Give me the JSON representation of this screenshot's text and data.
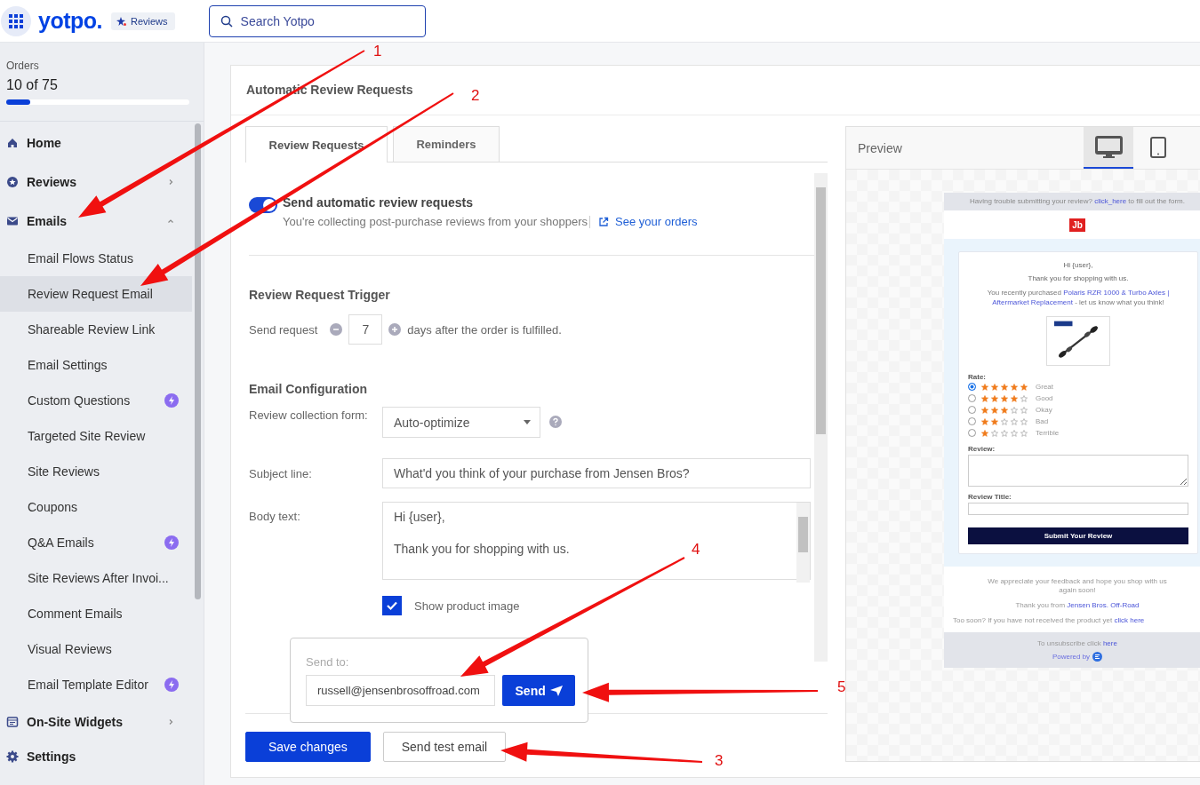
{
  "topbar": {
    "logo": "yotpo.",
    "product_badge": "Reviews",
    "search": {
      "placeholder": "Search Yotpo"
    }
  },
  "sidebar": {
    "orders": {
      "label": "Orders",
      "count": "10 of 75",
      "level": 0.13
    },
    "items": [
      {
        "label": "Home",
        "kind": "link"
      },
      {
        "label": "Reviews",
        "kind": "group",
        "expanded": false
      },
      {
        "label": "Emails",
        "kind": "group",
        "expanded": true,
        "children": [
          {
            "label": "Email Flows Status",
            "selected": false,
            "premium": false
          },
          {
            "label": "Review Request Email",
            "selected": true,
            "premium": false
          },
          {
            "label": "Shareable Review Link",
            "selected": false,
            "premium": false
          },
          {
            "label": "Email Settings",
            "selected": false,
            "premium": false
          },
          {
            "label": "Custom Questions",
            "selected": false,
            "premium": true
          },
          {
            "label": "Targeted Site Review",
            "selected": false,
            "premium": false
          },
          {
            "label": "Site Reviews",
            "selected": false,
            "premium": false
          },
          {
            "label": "Coupons",
            "selected": false,
            "premium": false
          },
          {
            "label": "Q&A Emails",
            "selected": false,
            "premium": true
          },
          {
            "label": "Site Reviews After Invoi...",
            "selected": false,
            "premium": false
          },
          {
            "label": "Comment Emails",
            "selected": false,
            "premium": false
          },
          {
            "label": "Visual Reviews",
            "selected": false,
            "premium": false
          },
          {
            "label": "Email Template Editor",
            "selected": false,
            "premium": true
          }
        ]
      },
      {
        "label": "On-Site Widgets",
        "kind": "group",
        "expanded": false
      },
      {
        "label": "Settings",
        "kind": "link"
      }
    ]
  },
  "page": {
    "title": "Automatic Review Requests",
    "tabs": [
      {
        "label": "Review Requests",
        "selected": true
      },
      {
        "label": "Reminders",
        "selected": false
      }
    ],
    "auto_send": {
      "label": "Send automatic review requests",
      "on": true,
      "description": "You're collecting post-purchase reviews from your shoppers",
      "link": "See your orders"
    },
    "trigger": {
      "heading": "Review Request Trigger",
      "label": "Send request",
      "value": "7",
      "suffix": "days after the order is fulfilled."
    },
    "config": {
      "heading": "Email Configuration",
      "form_label": "Review collection form:",
      "form_value": "Auto-optimize",
      "subject_label": "Subject line:",
      "subject_value": "What'd you think of your purchase from Jensen Bros?",
      "body_label": "Body text:",
      "body_value": "Hi {user},\n\nThank you for shopping with us.",
      "show_image": {
        "label": "Show product image",
        "checked": true
      }
    },
    "send_popup": {
      "label": "Send to:",
      "value": "russell@jensenbrosoffroad.com",
      "button": "Send"
    },
    "buttons": [
      {
        "label": "Save changes",
        "kind": "primary"
      },
      {
        "label": "Send test email",
        "kind": "secondary"
      }
    ]
  },
  "preview": {
    "title": "Preview",
    "devices": [
      {
        "kind": "desktop",
        "selected": true
      },
      {
        "kind": "tablet",
        "selected": false
      }
    ],
    "email": {
      "notice": {
        "before": "Having trouble submitting your review? ",
        "link": "click_here",
        "after": " to fill out the form."
      },
      "logo": "Jb",
      "greeting": "Hi {user},",
      "thanks": "Thank you for shopping with us.",
      "purchase": [
        {
          "before": "You recently purchased ",
          "link": "Polaris RZR 1000 & Turbo Axles |"
        },
        {
          "link": "Aftermarket Replacement",
          "after": " - let us know what you think!"
        }
      ],
      "rate_label": "Rate:",
      "ratings": [
        {
          "label": "Great",
          "stars": 5,
          "selected": true
        },
        {
          "label": "Good",
          "stars": 4,
          "selected": false
        },
        {
          "label": "Okay",
          "stars": 3,
          "selected": false
        },
        {
          "label": "Bad",
          "stars": 2,
          "selected": false
        },
        {
          "label": "Terrible",
          "stars": 1,
          "selected": false
        }
      ],
      "review_label": "Review:",
      "title_label": "Review Title:",
      "submit": "Submit Your Review",
      "appreciate": "We appreciate your feedback and hope you shop with us again soon!",
      "from": {
        "before": "Thank you from ",
        "link": "Jensen Bros. Off-Road"
      },
      "too_soon": {
        "before": "Too soon? If you have not received the product yet ",
        "link": "click here"
      },
      "unsubscribe": {
        "before": "To unsubscribe click ",
        "link": "here"
      },
      "powered": "Powered by"
    }
  },
  "annotations": [
    {
      "number": "1"
    },
    {
      "number": "2"
    },
    {
      "number": "3"
    },
    {
      "number": "4"
    },
    {
      "number": "5"
    }
  ]
}
